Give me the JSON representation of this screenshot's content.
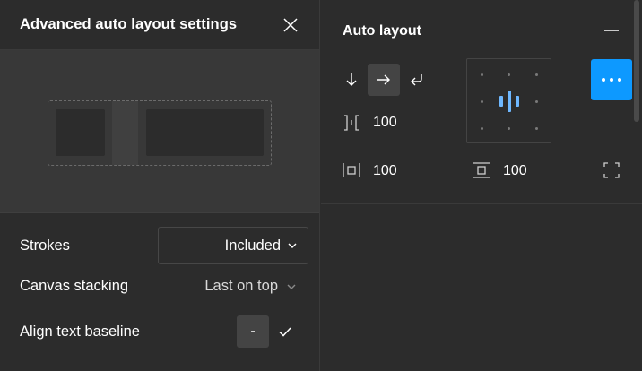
{
  "popover": {
    "title": "Advanced auto layout settings",
    "close_icon": "close-icon",
    "strokes_label": "Strokes",
    "strokes_value": "Included",
    "canvas_stacking_label": "Canvas stacking",
    "canvas_stacking_value": "Last on top",
    "align_baseline_label": "Align text baseline",
    "align_baseline_off": "-",
    "align_baseline_on_icon": "checkmark-icon"
  },
  "panel": {
    "title": "Auto layout",
    "direction_icons": [
      "arrow-down-icon",
      "arrow-right-icon",
      "wrap-icon"
    ],
    "active_direction": "arrow-right-icon",
    "gap_value": "100",
    "horizontal_padding_value": "100",
    "vertical_padding_value": "100",
    "more_button_icon": "more-horizontal-icon",
    "accent_color": "#0d99ff"
  }
}
